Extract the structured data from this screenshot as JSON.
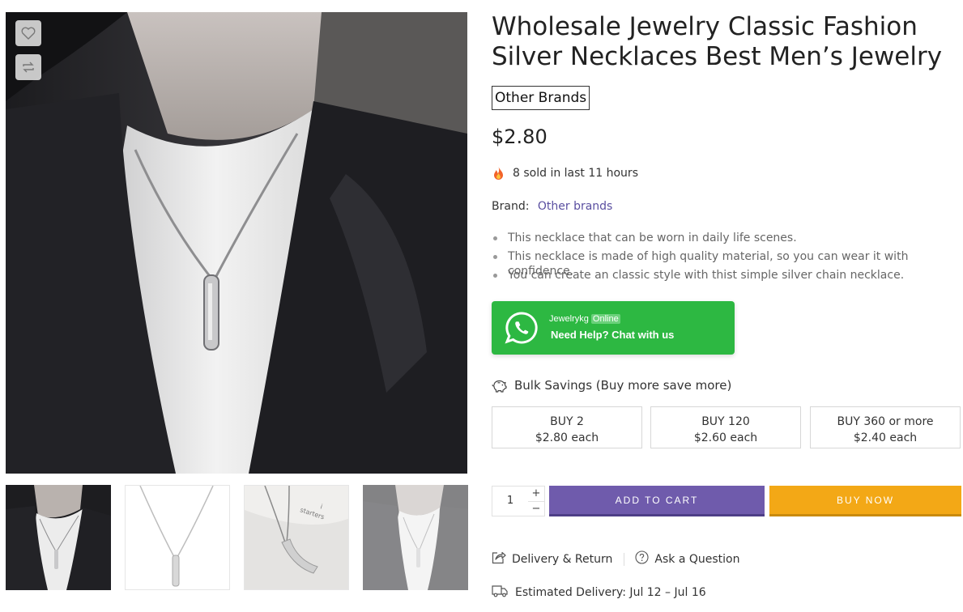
{
  "product": {
    "title": "Wholesale Jewelry Classic Fashion Silver Necklaces Best Men’s Jewelry",
    "brand_badge": "Other Brands",
    "price": "$2.80",
    "sold_text": "8 sold in last 11 hours",
    "brand_label": "Brand:",
    "brand_link": "Other brands",
    "bullets": [
      "This necklace that can be worn in daily life scenes.",
      "This necklace is made of high quality material, so you can wear it with confidence.",
      "You can create an classic style with thist simple silver chain necklace."
    ]
  },
  "whatsapp": {
    "name": "Jewelrykg",
    "status": "Online",
    "help": "Need Help? Chat with us",
    "color": "#2db842"
  },
  "bulk": {
    "title": "Bulk Savings (Buy more save more)",
    "tiers": [
      {
        "qty": "BUY 2",
        "price": "$2.80 each"
      },
      {
        "qty": "BUY 120",
        "price": "$2.60 each"
      },
      {
        "qty": "BUY 360 or more",
        "price": "$2.40 each"
      }
    ]
  },
  "purchase": {
    "quantity": "1",
    "plus": "+",
    "minus": "−",
    "add_to_cart": "ADD TO CART",
    "buy_now": "BUY NOW",
    "cart_color": "#6f5bac",
    "buy_color": "#f3a816"
  },
  "links": {
    "delivery_return": "Delivery & Return",
    "ask_question": "Ask a Question"
  },
  "delivery": {
    "text": "Estimated Delivery: Jul 12 – Jul 16"
  },
  "gallery": {
    "thumb3_caption_line1": "i",
    "thumb3_caption_line2": "starters"
  },
  "icons": {
    "wishlist": "heart-icon",
    "compare": "compare-arrows-icon",
    "fire": "fire-icon",
    "piggy": "piggy-bank-icon",
    "whatsapp": "whatsapp-icon",
    "delivery_return": "share-box-icon",
    "ask": "question-circle-icon",
    "truck": "truck-icon"
  }
}
